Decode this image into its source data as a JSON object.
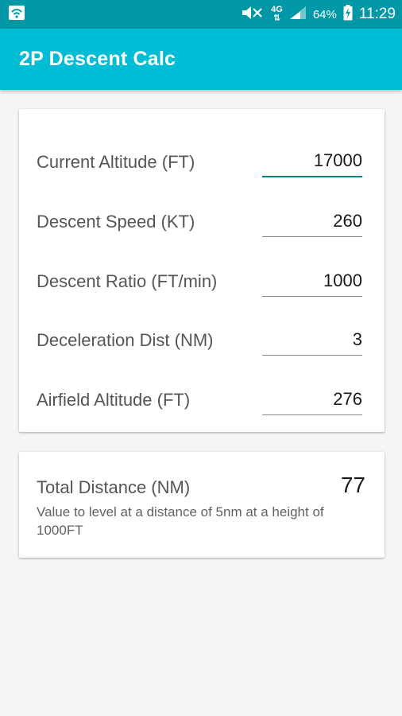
{
  "status_bar": {
    "battery": "64%",
    "network": "4G",
    "time": "11:29"
  },
  "app_bar": {
    "title": "2P Descent Calc"
  },
  "inputs": [
    {
      "label": "Current Altitude (FT)",
      "value": "17000"
    },
    {
      "label": "Descent Speed (KT)",
      "value": "260"
    },
    {
      "label": "Descent Ratio (FT/min)",
      "value": "1000"
    },
    {
      "label": "Deceleration Dist (NM)",
      "value": "3"
    },
    {
      "label": "Airfield Altitude (FT)",
      "value": "276"
    }
  ],
  "result": {
    "label": "Total Distance (NM)",
    "value": "77",
    "note": "Value to level at a distance of 5nm at a height of 1000FT"
  },
  "colors": {
    "status_bar": "#0097a7",
    "app_bar": "#00bcd4",
    "focus_underline": "#00897b"
  }
}
